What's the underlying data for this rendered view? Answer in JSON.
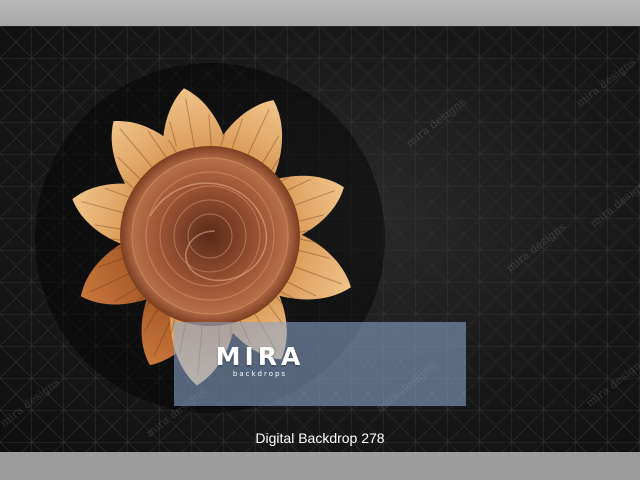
{
  "watermark_text": "mira designs",
  "logo": {
    "name": "MIRA",
    "tagline": "backdrops"
  },
  "caption": "Digital Backdrop 278",
  "colors": {
    "background": "#151515",
    "grid_lines": "#3a3a3a",
    "petal_light": "#e8b06e",
    "petal_dark": "#7a3a14",
    "center": "#8a4a2c",
    "logo_overlay": "#8ca5cd"
  }
}
